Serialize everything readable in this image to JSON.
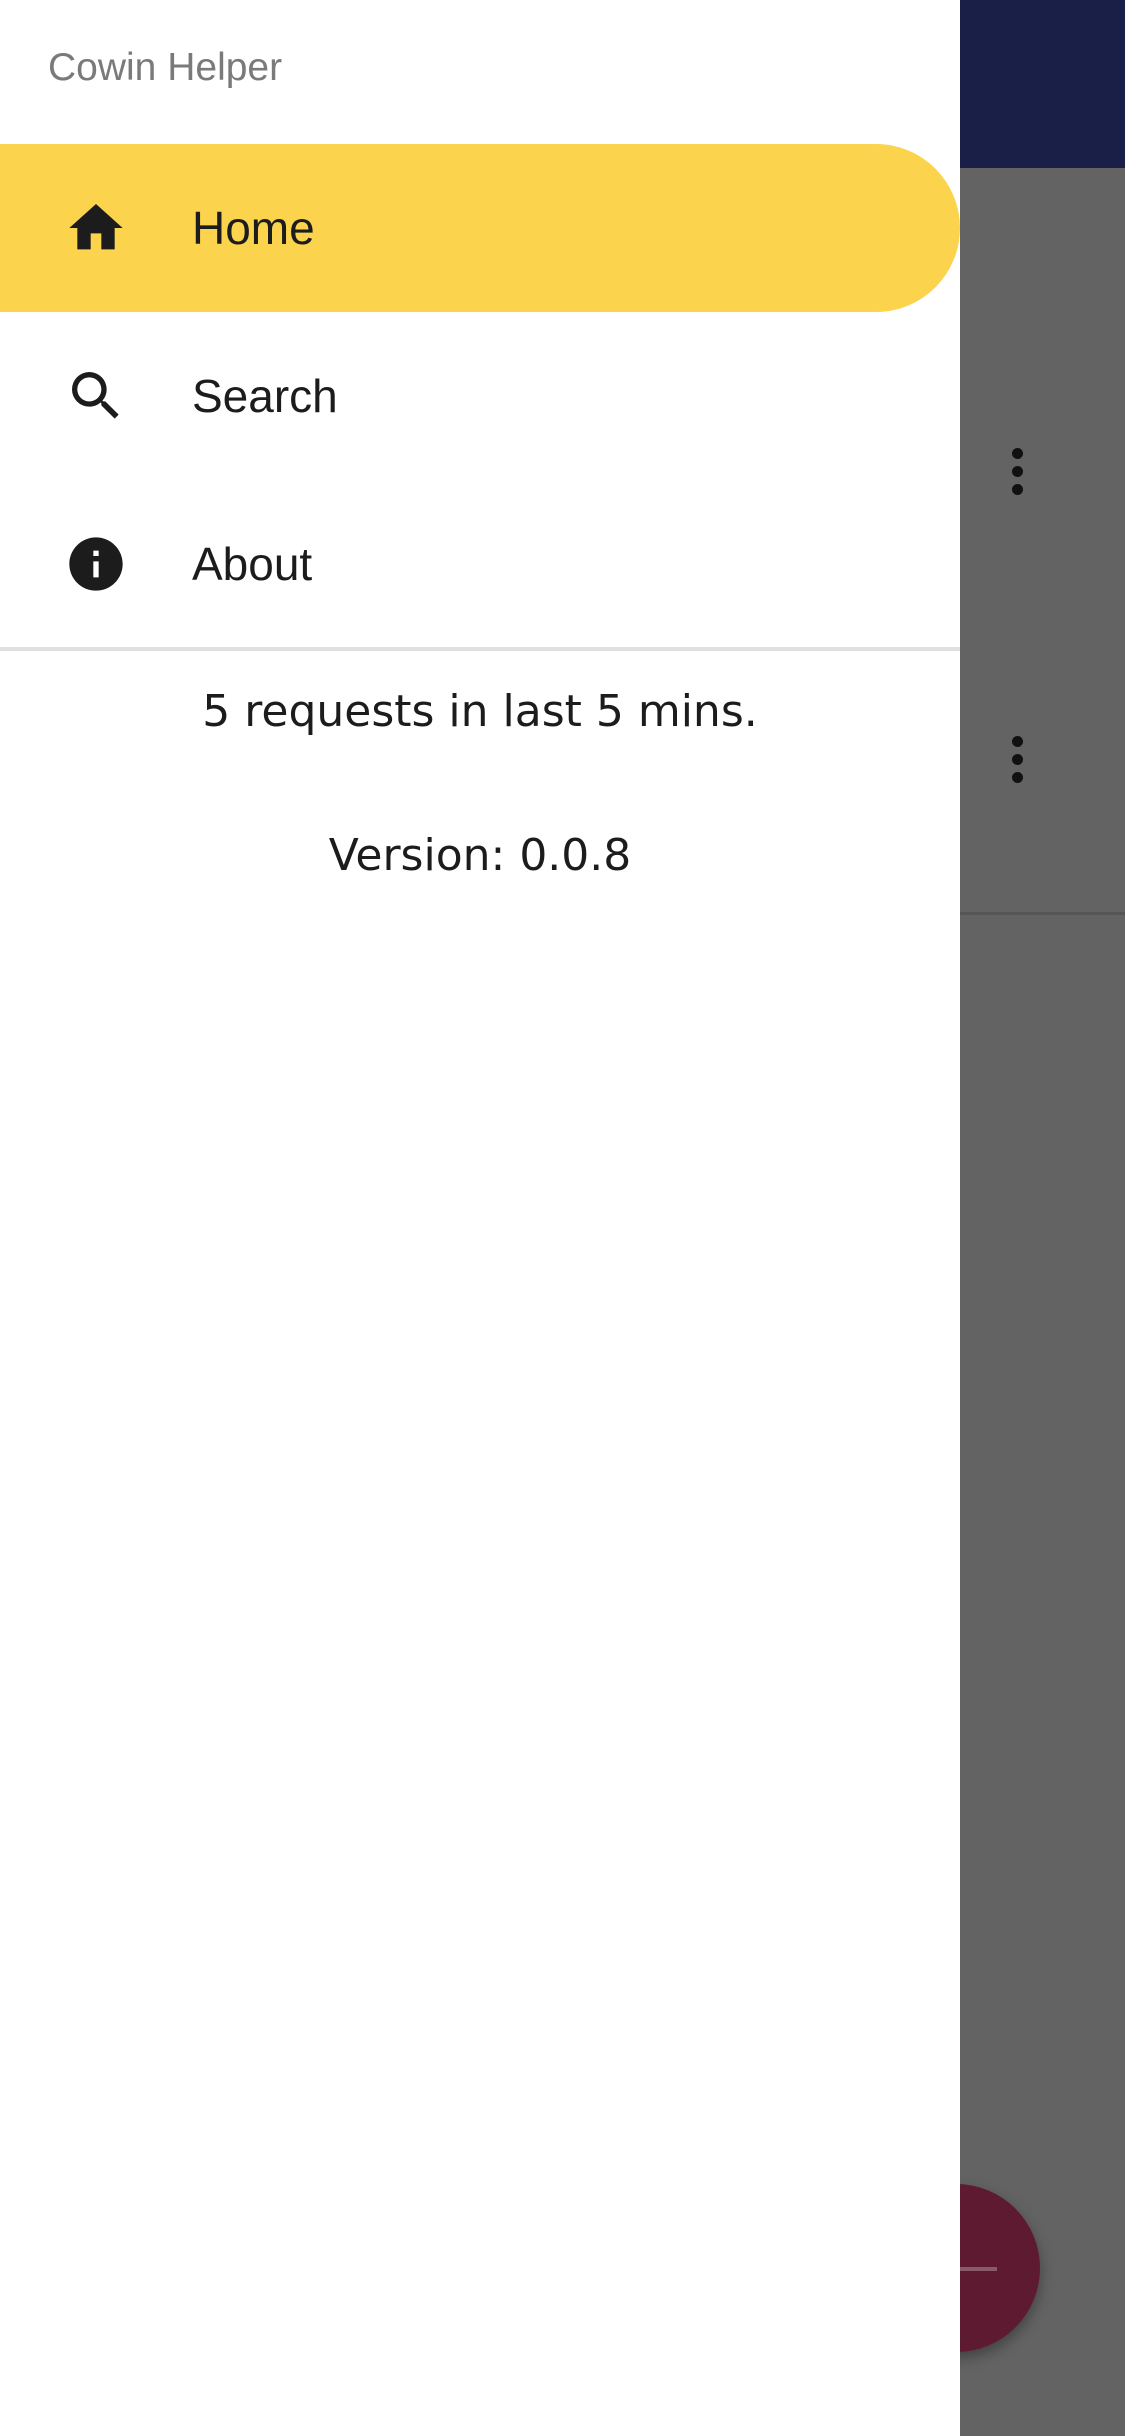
{
  "app": {
    "title": "Cowin Helper"
  },
  "drawer": {
    "items": [
      {
        "label": "Home",
        "icon": "home-icon",
        "active": true
      },
      {
        "label": "Search",
        "icon": "search-icon",
        "active": false
      },
      {
        "label": "About",
        "icon": "info-icon",
        "active": false
      }
    ],
    "stats": "5 requests in last 5 mins.",
    "version": "Version: 0.0.8"
  },
  "colors": {
    "active_item": "#fcd34d",
    "app_bar": "#1a1f48",
    "fab": "#5e1a30",
    "scrim": "#636363"
  }
}
